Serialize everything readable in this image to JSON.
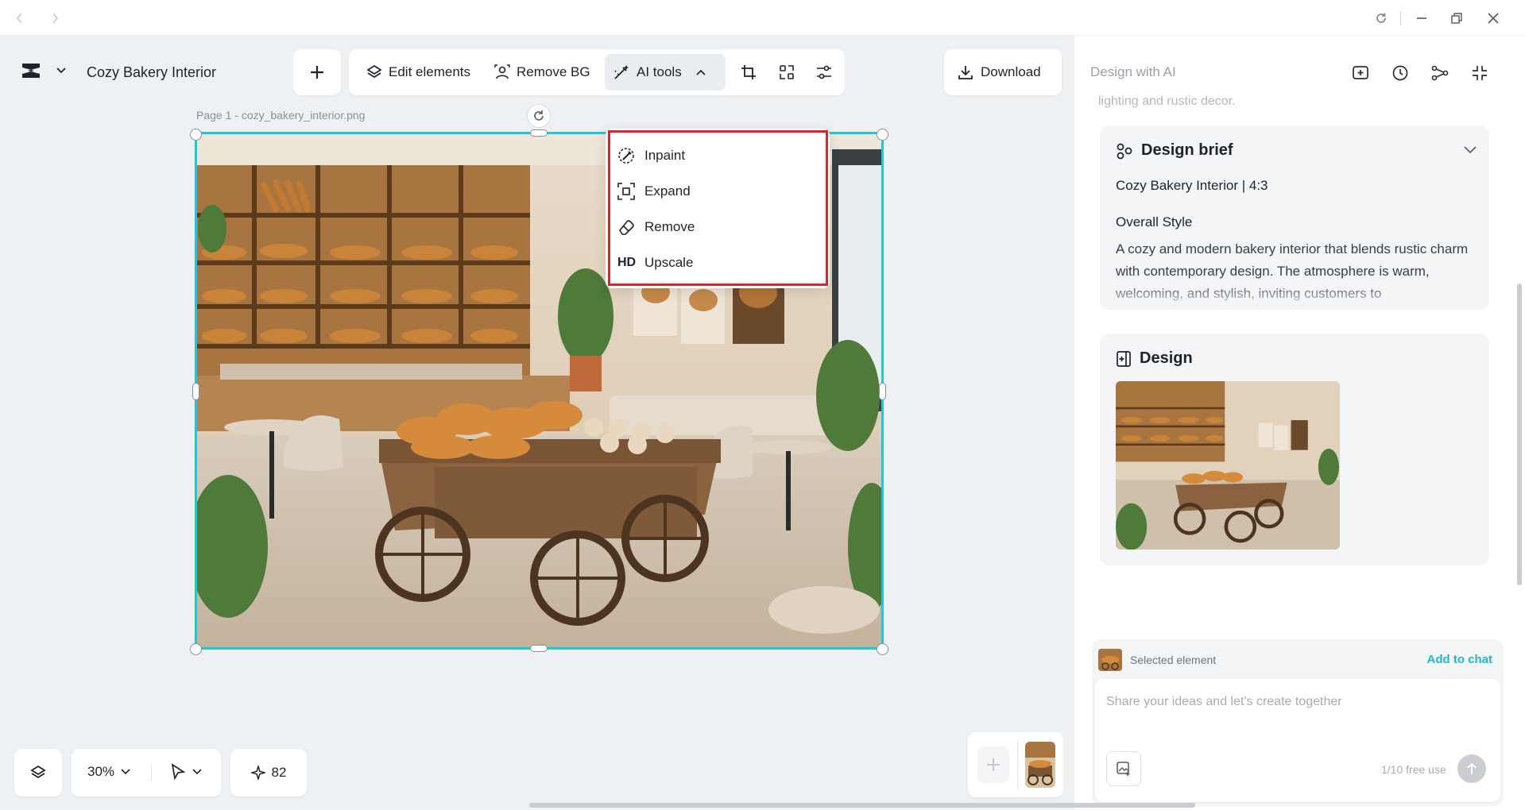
{
  "window": {
    "back_icon": "chevron-left-icon",
    "forward_icon": "chevron-right-icon",
    "controls": [
      "refresh-icon",
      "minimize-icon",
      "restore-icon",
      "close-icon"
    ]
  },
  "project": {
    "title": "Cozy Bakery Interior"
  },
  "toolbar": {
    "edit_elements": "Edit elements",
    "remove_bg": "Remove BG",
    "ai_tools": "AI tools",
    "download": "Download"
  },
  "canvas": {
    "page_label": "Page 1 -  cozy_bakery_interior.png"
  },
  "ai_tools_menu": {
    "items": [
      {
        "label": "Inpaint",
        "icon": "inpaint-icon"
      },
      {
        "label": "Expand",
        "icon": "expand-icon"
      },
      {
        "label": "Remove",
        "icon": "eraser-icon"
      },
      {
        "label": "Upscale",
        "icon": "HD"
      }
    ]
  },
  "bottom_bar": {
    "zoom": "30%",
    "credits": "82"
  },
  "right_panel": {
    "title": "Design with AI",
    "faded_text": "lighting and rustic decor.",
    "brief": {
      "title": "Design brief",
      "subtitle": "Cozy Bakery Interior | 4:3",
      "style_heading": "Overall Style",
      "style_text": "A cozy and modern bakery interior that blends rustic charm with contemporary design. The atmosphere is warm, welcoming, and stylish, inviting customers to"
    },
    "design": {
      "title": "Design"
    },
    "chat": {
      "selected_element": "Selected element",
      "add_to_chat": "Add to chat",
      "placeholder": "Share your ideas and let's create together",
      "free_use": "1/10 free use"
    }
  },
  "colors": {
    "selection": "#23c6d8",
    "menu_highlight": "#e0242b",
    "accent_link": "#1fb8c9"
  }
}
